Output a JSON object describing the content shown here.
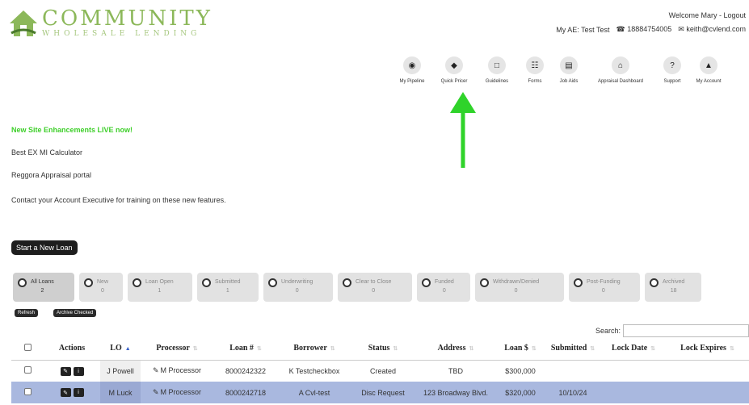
{
  "brand": {
    "title": "COMMUNITY",
    "subtitle": "WHOLESALE LENDING",
    "color": "#8cb85a"
  },
  "header": {
    "welcome": "Welcome Mary -",
    "logout": "Logout",
    "ae": "My AE: Test Test",
    "phone": "☎ 18884754005",
    "email": "✉ keith@cvlend.com"
  },
  "nav": [
    {
      "label": "My Pipeline",
      "icon": "binoculars-icon",
      "glyph": "◉"
    },
    {
      "label": "Quick Pricer",
      "icon": "tag-icon",
      "glyph": "◆"
    },
    {
      "label": "Guidelines",
      "icon": "document-icon",
      "glyph": "□"
    },
    {
      "label": "Forms",
      "icon": "grid-icon",
      "glyph": "☷"
    },
    {
      "label": "Job Aids",
      "icon": "id-card-icon",
      "glyph": "▤"
    },
    {
      "label": "Appraisal Dashboard",
      "icon": "home-icon",
      "glyph": "⌂"
    },
    {
      "label": "Support",
      "icon": "question-icon",
      "glyph": "?"
    },
    {
      "label": "My Account",
      "icon": "user-icon",
      "glyph": "▲"
    }
  ],
  "announcements": {
    "title": "New Site Enhancements LIVE now!",
    "lines": [
      "Best EX MI Calculator",
      "Reggora Appraisal portal",
      "Contact your Account Executive for training on these new features."
    ]
  },
  "start_button": "Start a New Loan",
  "tabs": [
    {
      "label": "All Loans",
      "count": "2",
      "active": true
    },
    {
      "label": "New",
      "count": "0"
    },
    {
      "label": "Loan Open",
      "count": "1"
    },
    {
      "label": "Submitted",
      "count": "1"
    },
    {
      "label": "Underwriting",
      "count": "0"
    },
    {
      "label": "Clear to Close",
      "count": "0"
    },
    {
      "label": "Funded",
      "count": "0"
    },
    {
      "label": "Withdrawn/Denied",
      "count": "0"
    },
    {
      "label": "Post-Funding",
      "count": "0"
    },
    {
      "label": "Archived",
      "count": "18"
    }
  ],
  "refresh": "Refresh",
  "archive_checked": "Archive Checked",
  "search_label": "Search:",
  "table": {
    "headers": [
      "Actions",
      "LO",
      "Processor",
      "Loan #",
      "Borrower",
      "Status",
      "Address",
      "Loan $",
      "Submitted",
      "Lock Date",
      "Lock Expires"
    ],
    "rows": [
      [
        "J Powell",
        "M Processor",
        "8000242322",
        "K Testcheckbox",
        "Created",
        "TBD",
        "$300,000",
        "",
        "",
        ""
      ],
      [
        "M Luck",
        "M Processor",
        "8000242718",
        "A Cvl-test",
        "Disc Request",
        "123 Broadway Blvd.",
        "$320,000",
        "10/10/24",
        "",
        ""
      ]
    ]
  },
  "accent_arrow": "#2fd32a"
}
